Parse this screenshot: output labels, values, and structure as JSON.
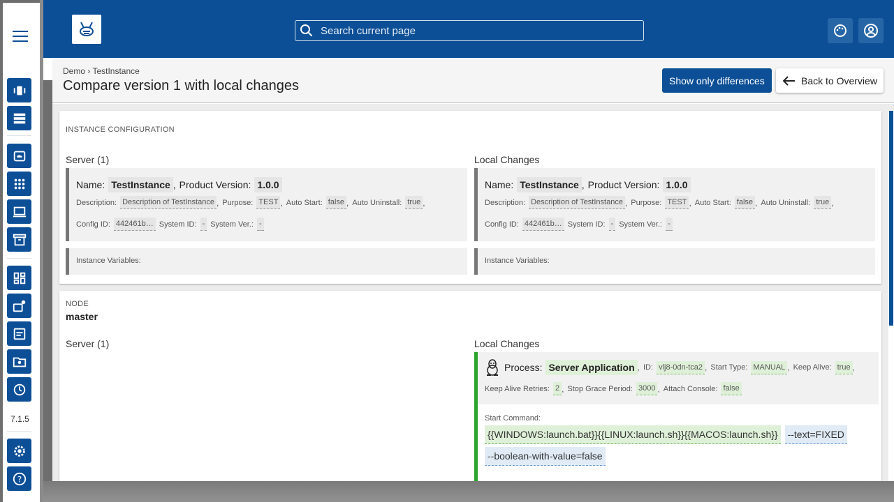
{
  "app": {
    "version": "7.1.5",
    "search_placeholder": "Search current page"
  },
  "colors": {
    "primary": "#0d4f96",
    "added": "#2ca52c",
    "added_bg": "#dff0d8",
    "changed_bg": "#e0ebf5"
  },
  "rail_icons": [
    "vibration-icon",
    "list-icon",
    "cloud-storage-icon",
    "apps-grid-icon",
    "computer-icon",
    "archive-icon",
    "dashboard-icon",
    "cloud-settings-icon",
    "file-list-icon",
    "folder-star-icon",
    "history-icon",
    "settings-icon",
    "help-icon"
  ],
  "header": {
    "breadcrumb": "Demo › TestInstance",
    "title": "Compare version 1 with local changes",
    "show_diff_label": "Show only differences",
    "back_label": "Back to Overview"
  },
  "instance_config": {
    "section_label": "INSTANCE CONFIGURATION",
    "left_title": "Server (1)",
    "right_title": "Local Changes",
    "name_label": "Name:",
    "name_value": "TestInstance",
    "product_version_label": "Product Version:",
    "product_version_value": "1.0.0",
    "description_label": "Description:",
    "description_value": "Description of TestInstance",
    "purpose_label": "Purpose:",
    "purpose_value": "TEST",
    "auto_start_label": "Auto Start:",
    "auto_start_value": "false",
    "auto_uninstall_label": "Auto Uninstall:",
    "auto_uninstall_value": "true",
    "config_id_label": "Config ID:",
    "config_id_value": "442461b…",
    "system_id_label": "System ID:",
    "system_id_value": "-",
    "system_ver_label": "System Ver.:",
    "system_ver_value": "-",
    "instance_variables_label": "Instance Variables:"
  },
  "node": {
    "section_label": "NODE",
    "name": "master",
    "left_title": "Server (1)",
    "right_title": "Local Changes",
    "process_label": "Process:",
    "process_value": "Server Application",
    "id_label": "ID:",
    "id_value": "vlj8-0dn-tca2",
    "start_type_label": "Start Type:",
    "start_type_value": "MANUAL",
    "keep_alive_label": "Keep Alive:",
    "keep_alive_value": "true",
    "keep_alive_retries_label": "Keep Alive Retries:",
    "keep_alive_retries_value": "2",
    "stop_grace_label": "Stop Grace Period:",
    "stop_grace_value": "3000",
    "attach_console_label": "Attach Console:",
    "attach_console_value": "false",
    "start_command_label": "Start Command:",
    "start_command_main": "{{WINDOWS:launch.bat}}{{LINUX:launch.sh}}{{MACOS:launch.sh}}",
    "start_command_arg1": "--text=FIXED",
    "start_command_arg2": "--boolean-with-value=false"
  }
}
